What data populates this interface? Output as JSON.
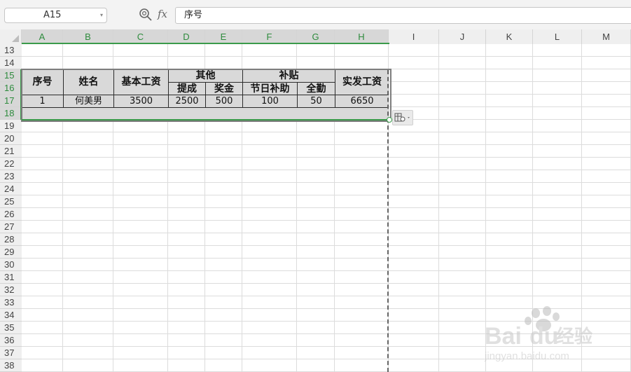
{
  "formula_bar": {
    "cell_ref": "A15",
    "fx_label": "fx",
    "formula_value": "序号"
  },
  "columns": [
    "A",
    "B",
    "C",
    "D",
    "E",
    "F",
    "G",
    "H",
    "I",
    "J",
    "K",
    "L",
    "M"
  ],
  "rows": [
    "13",
    "14",
    "15",
    "16",
    "17",
    "18",
    "19",
    "20",
    "21",
    "22",
    "23",
    "24",
    "25",
    "26",
    "27",
    "28",
    "29",
    "30",
    "31",
    "32",
    "33",
    "34",
    "35",
    "36",
    "37",
    "38"
  ],
  "table": {
    "headers": {
      "seq": "序号",
      "name": "姓名",
      "base": "基本工资",
      "other": "其他",
      "commission": "提成",
      "bonus": "奖金",
      "allowance": "补贴",
      "holiday": "节日补助",
      "attendance": "全勤",
      "net": "实发工资"
    },
    "row": {
      "seq": "1",
      "name": "何美男",
      "base": "3500",
      "commission": "2500",
      "bonus": "500",
      "holiday": "100",
      "attendance": "50",
      "net": "6650"
    }
  },
  "watermark": {
    "brand": "Bai",
    "suffix": "du",
    "product": "经验",
    "url": "jingyan.baidu.com"
  },
  "colors": {
    "selection_green": "#3a9a4a",
    "header_bg": "#efefef",
    "selected_header_bg": "#d7d7d7",
    "selection_fill": "#d9d9d9"
  }
}
